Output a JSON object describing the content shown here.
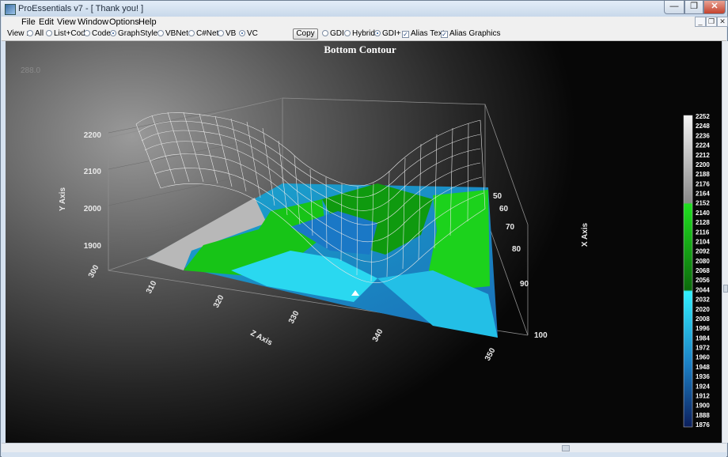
{
  "window": {
    "title": "ProEssentials v7 - [ Thank you! ]",
    "min_glyph": "—",
    "max_glyph": "❐",
    "close_glyph": "✕"
  },
  "menubar": {
    "items": [
      "File",
      "Edit",
      "View",
      "Window",
      "Options",
      "Help"
    ],
    "mdi_min": "_",
    "mdi_restore": "❐",
    "mdi_close": "✕"
  },
  "toolbar": {
    "view_label": "View :",
    "view_options": [
      {
        "label": "All",
        "selected": false
      },
      {
        "label": "List+Code",
        "selected": false
      },
      {
        "label": "Code",
        "selected": false
      },
      {
        "label": "Graph",
        "selected": true
      }
    ],
    "style_label": "Style :",
    "style_options": [
      {
        "label": "VBNet",
        "selected": false
      },
      {
        "label": "C#Net",
        "selected": false
      },
      {
        "label": "VB",
        "selected": false
      },
      {
        "label": "VC",
        "selected": true
      }
    ],
    "copy_label": "Copy",
    "render_options": [
      {
        "label": "GDI",
        "selected": false
      },
      {
        "label": "Hybrid",
        "selected": false
      },
      {
        "label": "GDI+",
        "selected": true
      }
    ],
    "checks": [
      {
        "label": "Alias Text",
        "checked": true
      },
      {
        "label": "Alias Graphics",
        "checked": true
      }
    ]
  },
  "chart": {
    "title": "Bottom Contour",
    "rotation_readout": "288.0",
    "y_axis_label": "Y Axis",
    "x_axis_label": "X Axis",
    "z_axis_label": "Z Axis",
    "y_ticks": [
      "2200",
      "2100",
      "2000",
      "1900"
    ],
    "x_ticks": [
      "50",
      "60",
      "70",
      "80",
      "90",
      "100"
    ],
    "z_ticks": [
      "300",
      "310",
      "320",
      "330",
      "340",
      "350"
    ],
    "legend_values": [
      "2252",
      "2248",
      "2236",
      "2224",
      "2212",
      "2200",
      "2188",
      "2176",
      "2164",
      "2152",
      "2140",
      "2128",
      "2116",
      "2104",
      "2092",
      "2080",
      "2068",
      "2056",
      "2044",
      "2032",
      "2020",
      "2008",
      "1996",
      "1984",
      "1972",
      "1960",
      "1948",
      "1936",
      "1924",
      "1912",
      "1900",
      "1888",
      "1876"
    ],
    "colors": {
      "gray_high": "#c8c8c8",
      "green": "#18c818",
      "cyan": "#2ad8f0",
      "blue_low": "#1a3a78",
      "mesh": "#e8e8e8"
    }
  }
}
